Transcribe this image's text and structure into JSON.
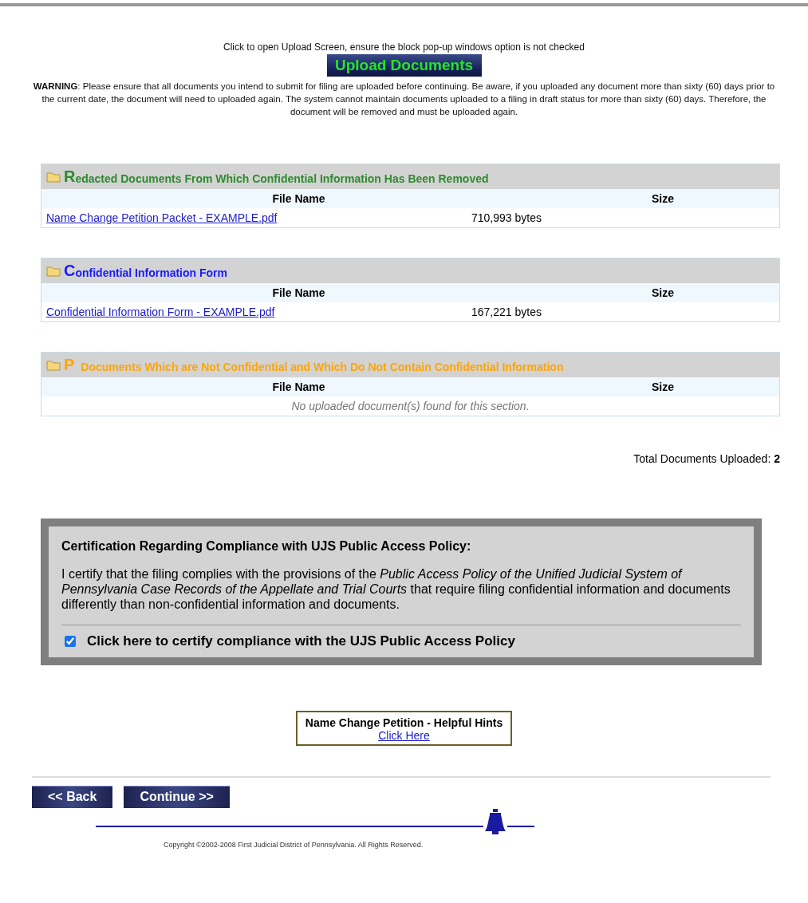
{
  "upload": {
    "hint": "Click to open Upload Screen, ensure the block pop-up windows option is not checked",
    "button": "Upload Documents"
  },
  "warning": "**WARNING**: Please ensure that all documents you intend to submit for filing are uploaded before continuing. Be aware, if you uploaded any document more than sixty (60) days prior to the current date, the document will need to uploaded again. The system cannot maintain documents uploaded to a filing in draft status for more than sixty (60) days. Therefore, the document will be removed and must be uploaded again.",
  "sections": [
    {
      "initial": "R",
      "title": "edacted Documents From Which Confidential Information Has Been Removed",
      "color": "#2e8b2e",
      "columns": [
        "File Name",
        "Size"
      ],
      "files": [
        {
          "name": "Name Change Petition Packet - EXAMPLE.pdf",
          "size": "710,993 bytes"
        }
      ]
    },
    {
      "initial": "C",
      "title": "onfidential Information Form",
      "color": "#1a1aff",
      "columns": [
        "File Name",
        "Size"
      ],
      "files": [
        {
          "name": "Confidential Information Form - EXAMPLE.pdf",
          "size": "167,221 bytes"
        }
      ]
    },
    {
      "initial": "P",
      "title": "Documents Which are Not Confidential and Which Do Not Contain Confidential Information",
      "color": "#ffa500",
      "columns": [
        "File Name",
        "Size"
      ],
      "empty": "No uploaded document(s) found for this section."
    }
  ],
  "total": {
    "label": "Total Documents Uploaded:",
    "value": "2"
  },
  "certification": {
    "heading": "Certification Regarding Compliance with UJS Public Access Policy:",
    "text": "I certify that the filing complies with the provisions of the *Public Access Policy of the Unified Judicial System of Pennsylvania Case Records of the Appellate and Trial Courts* that require filing confidential information and documents differently than non-confidential information and documents.",
    "checkbox": {
      "label": "Click here to certify compliance with the UJS Public Access Policy",
      "checked": true
    }
  },
  "hints": {
    "title": "Name Change Petition - Helpful Hints",
    "link": "Click Here"
  },
  "buttons": [
    "<< Back",
    "Continue >>"
  ],
  "copyright": "Copyright ©2002-2008 First Judicial District of Pennsylvania. All Rights Reserved."
}
